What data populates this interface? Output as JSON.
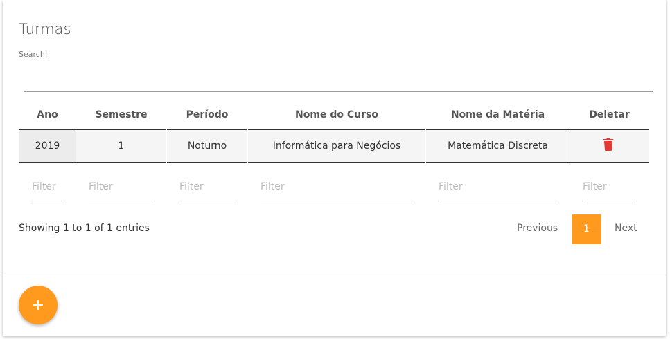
{
  "page": {
    "title": "Turmas",
    "search_label": "Search:",
    "search_value": ""
  },
  "table": {
    "headers": [
      "Ano",
      "Semestre",
      "Período",
      "Nome do Curso",
      "Nome da Matéria",
      "Deletar"
    ],
    "rows": [
      {
        "ano": "2019",
        "semestre": "1",
        "periodo": "Noturno",
        "curso": "Informática para Negócios",
        "materia": "Matemática Discreta",
        "deletar_icon": "trash-icon"
      }
    ],
    "filters": [
      "Filter",
      "Filter",
      "Filter",
      "Filter",
      "Filter",
      "Filter"
    ]
  },
  "footer": {
    "info": "Showing 1 to 1 of 1 entries",
    "previous": "Previous",
    "current_page": "1",
    "next": "Next"
  },
  "fab": {
    "icon": "plus-icon"
  },
  "colors": {
    "accent": "#ff9a1f",
    "delete": "#e53935",
    "row_bg": "#f5f5f5"
  }
}
